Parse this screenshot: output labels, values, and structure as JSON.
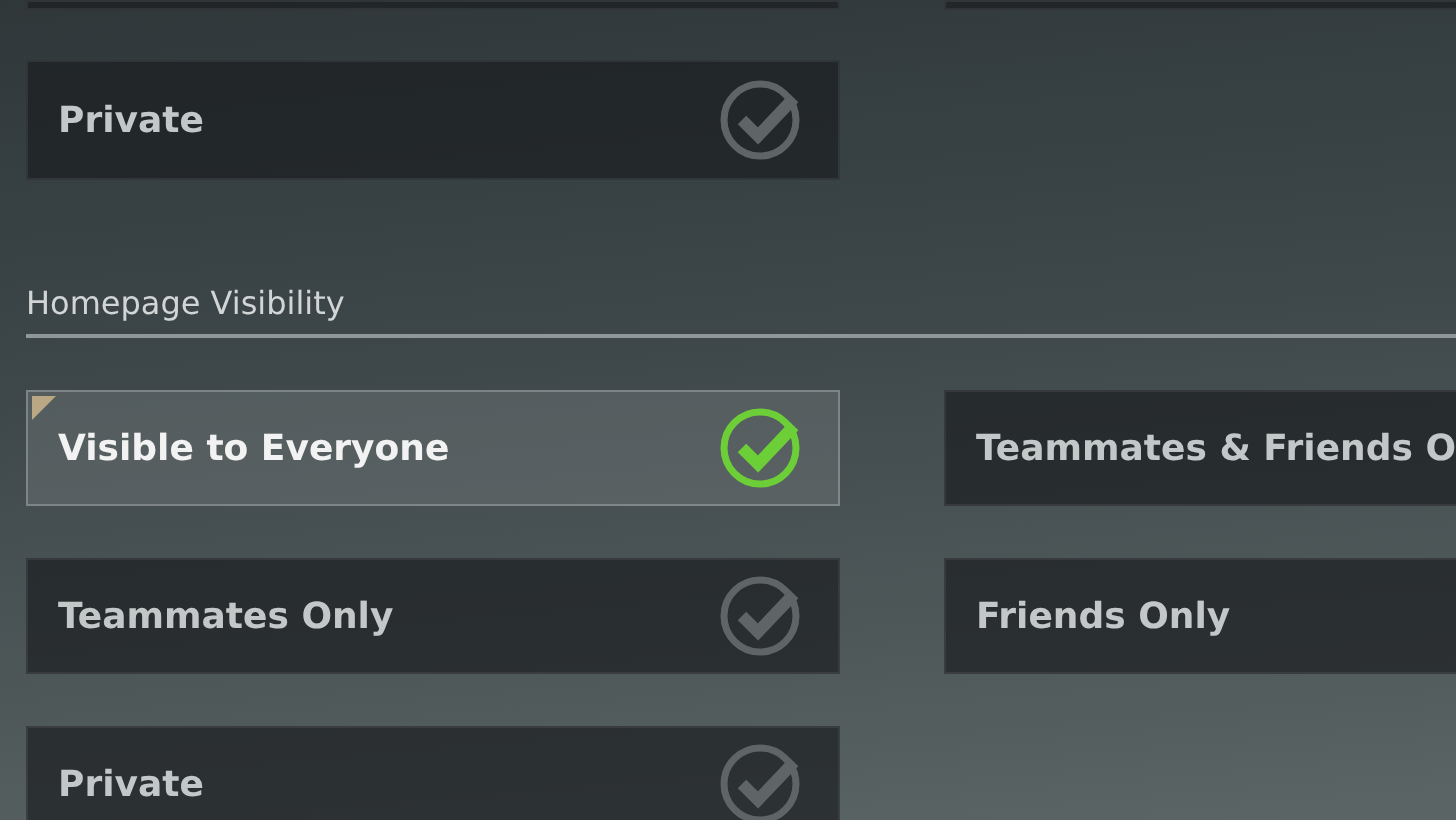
{
  "upper_section": {
    "options": [
      {
        "label": "Private",
        "selected": false
      }
    ]
  },
  "homepage_visibility": {
    "title": "Homepage Visibility",
    "options": [
      {
        "label": "Visible to Everyone",
        "selected": true
      },
      {
        "label": "Teammates & Friends O",
        "selected": false
      },
      {
        "label": "Teammates Only",
        "selected": false
      },
      {
        "label": "Friends Only",
        "selected": false
      },
      {
        "label": "Private",
        "selected": false
      }
    ]
  }
}
